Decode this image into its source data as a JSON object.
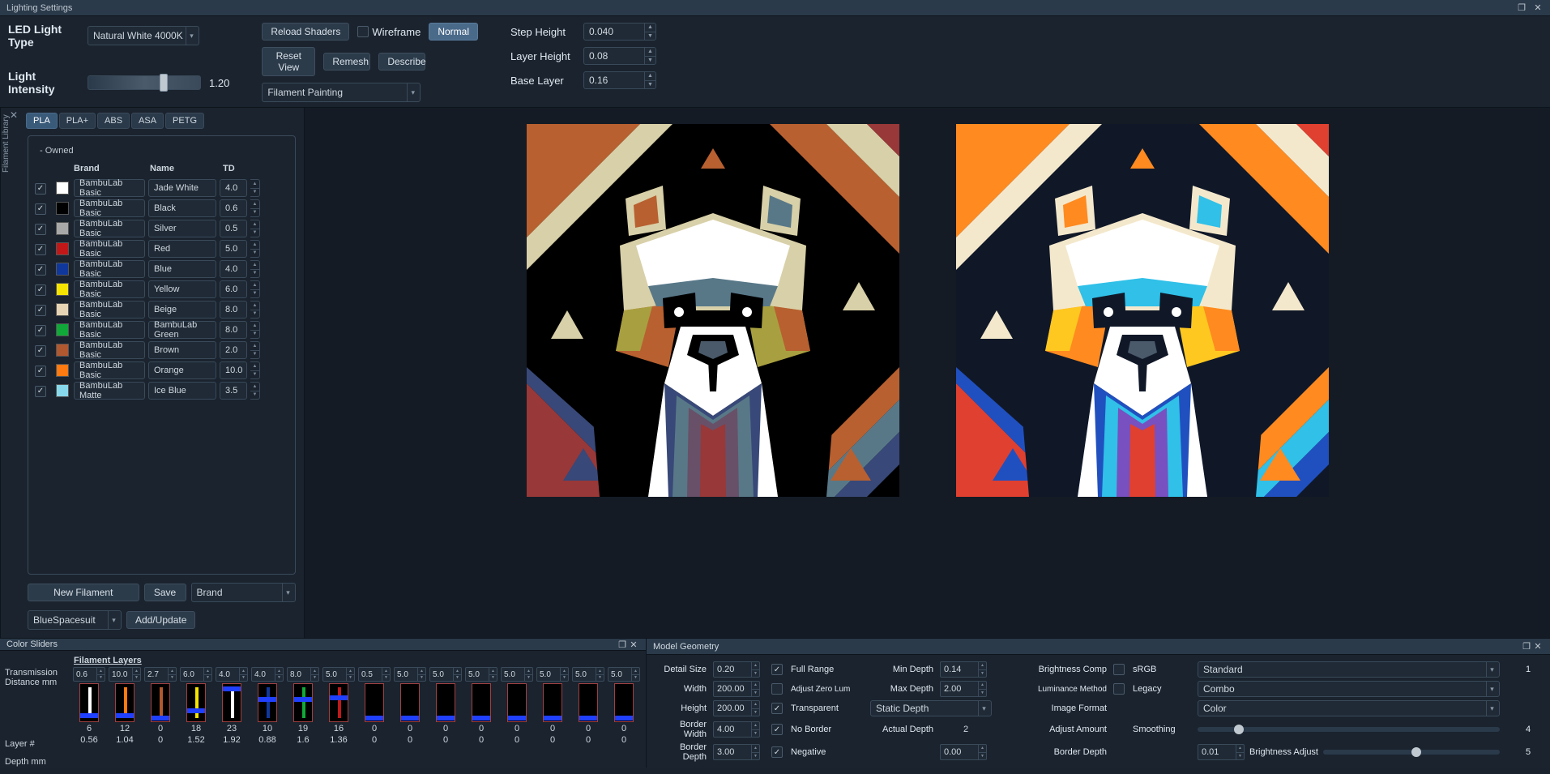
{
  "window": {
    "title": "Lighting Settings"
  },
  "topbar": {
    "ledLightTypeLabel": "LED Light Type",
    "ledLightTypeValue": "Natural White 4000K",
    "lightIntensityLabel": "Light Intensity",
    "lightIntensityValue": "1.20",
    "reloadShaders": "Reload Shaders",
    "wireframeLabel": "Wireframe",
    "normalBtn": "Normal",
    "resetView": "Reset View",
    "remesh": "Remesh",
    "describe": "Describe",
    "modeDropdown": "Filament Painting",
    "stepHeightLabel": "Step Height",
    "stepHeightValue": "0.040",
    "layerHeightLabel": "Layer Height",
    "layerHeightValue": "0.08",
    "baseLayerLabel": "Base Layer",
    "baseLayerValue": "0.16"
  },
  "sideTab": "Filament Library",
  "materialTabs": [
    "PLA",
    "PLA+",
    "ABS",
    "ASA",
    "PETG"
  ],
  "filamentGroup": "- Owned",
  "filamentHeaders": {
    "brand": "Brand",
    "name": "Name",
    "td": "TD"
  },
  "filaments": [
    {
      "checked": true,
      "color": "#ffffff",
      "brand": "BambuLab Basic",
      "name": "Jade White",
      "td": "4.0"
    },
    {
      "checked": true,
      "color": "#000000",
      "brand": "BambuLab Basic",
      "name": "Black",
      "td": "0.6"
    },
    {
      "checked": true,
      "color": "#a8a8a8",
      "brand": "BambuLab Basic",
      "name": "Silver",
      "td": "0.5"
    },
    {
      "checked": true,
      "color": "#c01818",
      "brand": "BambuLab Basic",
      "name": "Red",
      "td": "5.0"
    },
    {
      "checked": true,
      "color": "#10389c",
      "brand": "BambuLab Basic",
      "name": "Blue",
      "td": "4.0"
    },
    {
      "checked": true,
      "color": "#f4e400",
      "brand": "BambuLab Basic",
      "name": "Yellow",
      "td": "6.0"
    },
    {
      "checked": true,
      "color": "#e6d4b4",
      "brand": "BambuLab Basic",
      "name": "Beige",
      "td": "8.0"
    },
    {
      "checked": true,
      "color": "#10a838",
      "brand": "BambuLab Basic",
      "name": "BambuLab Green",
      "td": "8.0"
    },
    {
      "checked": true,
      "color": "#b05830",
      "brand": "BambuLab Basic",
      "name": "Brown",
      "td": "2.0"
    },
    {
      "checked": true,
      "color": "#ff7a10",
      "brand": "BambuLab Basic",
      "name": "Orange",
      "td": "10.0"
    },
    {
      "checked": true,
      "color": "#88d8ec",
      "brand": "BambuLab Matte",
      "name": "Ice Blue",
      "td": "3.5"
    }
  ],
  "filamentFooter": {
    "newFilament": "New Filament",
    "save": "Save",
    "brandDropdown": "Brand",
    "userName": "BlueSpacesuit",
    "addUpdate": "Add/Update"
  },
  "colorSliders": {
    "title": "Color Sliders",
    "transmissionLabel": "Transmission\nDistance mm",
    "filamentLayersTitle": "Filament Layers",
    "layerNumLabel": "Layer #",
    "depthLabel": "Depth mm",
    "columns": [
      {
        "td": "0.6",
        "stripe": "#ffffff",
        "knob": 0.85,
        "layer": "6",
        "depth": "0.56"
      },
      {
        "td": "10.0",
        "stripe": "#ff7a10",
        "knob": 0.85,
        "layer": "12",
        "depth": "1.04"
      },
      {
        "td": "2.7",
        "stripe": "#b05830",
        "knob": 0.92,
        "layer": "0",
        "depth": "0"
      },
      {
        "td": "6.0",
        "stripe": "#f4e400",
        "knob": 0.7,
        "layer": "18",
        "depth": "1.52"
      },
      {
        "td": "4.0",
        "stripe": "#ffffff",
        "knob": 0.02,
        "layer": "23",
        "depth": "1.92"
      },
      {
        "td": "4.0",
        "stripe": "#10389c",
        "knob": 0.35,
        "layer": "10",
        "depth": "0.88"
      },
      {
        "td": "8.0",
        "stripe": "#10a838",
        "knob": 0.35,
        "layer": "19",
        "depth": "1.6"
      },
      {
        "td": "5.0",
        "stripe": "#c01818",
        "knob": 0.3,
        "layer": "16",
        "depth": "1.36"
      },
      {
        "td": "0.5",
        "stripe": null,
        "knob": 0.92,
        "layer": "0",
        "depth": "0"
      },
      {
        "td": "5.0",
        "stripe": null,
        "knob": 0.92,
        "layer": "0",
        "depth": "0"
      },
      {
        "td": "5.0",
        "stripe": null,
        "knob": 0.92,
        "layer": "0",
        "depth": "0"
      },
      {
        "td": "5.0",
        "stripe": null,
        "knob": 0.92,
        "layer": "0",
        "depth": "0"
      },
      {
        "td": "5.0",
        "stripe": null,
        "knob": 0.92,
        "layer": "0",
        "depth": "0"
      },
      {
        "td": "5.0",
        "stripe": null,
        "knob": 0.92,
        "layer": "0",
        "depth": "0"
      },
      {
        "td": "5.0",
        "stripe": null,
        "knob": 0.92,
        "layer": "0",
        "depth": "0"
      },
      {
        "td": "5.0",
        "stripe": null,
        "knob": 0.92,
        "layer": "0",
        "depth": "0"
      }
    ]
  },
  "modelGeometry": {
    "title": "Model Geometry",
    "rows": {
      "detailSize": "Detail Size",
      "detailSizeV": "0.20",
      "fullRange": "Full Range",
      "minDepth": "Min Depth",
      "minDepthV": "0.14",
      "brightnessComp": "Brightness Comp",
      "srgb": "sRGB",
      "brightDrop": "Standard",
      "brightNum": "1",
      "width": "Width",
      "widthV": "200.00",
      "adjustZero": "Adjust Zero Lum",
      "maxDepth": "Max Depth",
      "maxDepthV": "2.00",
      "lumMethod": "Luminance Method",
      "legacy": "Legacy",
      "lumDrop": "Combo",
      "height": "Height",
      "heightV": "200.00",
      "transparent": "Transparent",
      "staticDepth": "Static Depth",
      "imageFormat": "Image Format",
      "colorDrop": "Color",
      "borderWidth": "Border Width",
      "borderWidthV": "4.00",
      "noBorder": "No Border",
      "actualDepth": "Actual Depth",
      "actualDepthV": "2",
      "adjustAmount": "Adjust Amount",
      "smoothing": "Smoothing",
      "smoothingV": "4",
      "borderDepth": "Border Depth",
      "borderDepthV": "3.00",
      "negative": "Negative",
      "negDepthV": "0.00",
      "borderDepth2V": "0.01",
      "brightnessAdjust": "Brightness Adjust",
      "brightAdjV": "5"
    }
  }
}
